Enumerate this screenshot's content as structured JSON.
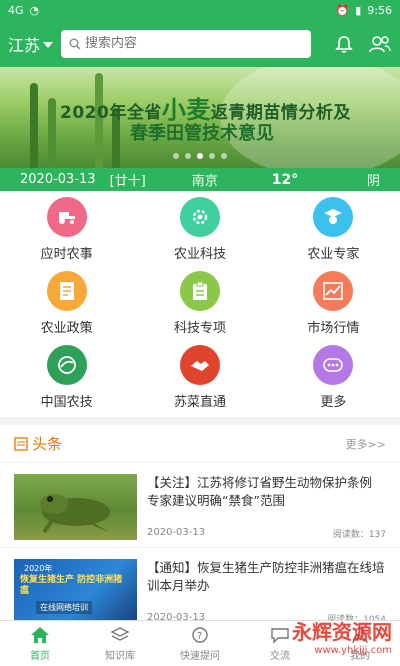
{
  "status_bar": {
    "left": "4G",
    "time": "9:56"
  },
  "header": {
    "city": "江苏",
    "search_placeholder": "搜索内容",
    "bell_icon": "bell-icon",
    "user_icon": "users-icon"
  },
  "banner": {
    "line1_prefix": "2020年全省",
    "line1_highlight": "小麦",
    "line1_suffix": "返青期苗情分析及",
    "line2": "春季田管技术意见",
    "dots_total": 5,
    "dots_active": 2
  },
  "weather": {
    "date": "2020-03-13",
    "lunar": "[廿十]",
    "city": "南京",
    "temp": "12°",
    "condition": "阴"
  },
  "features": [
    {
      "label": "应时农事",
      "icon": "tractor-icon",
      "color": "#f06a87"
    },
    {
      "label": "农业科技",
      "icon": "gear-icon",
      "color": "#3fcfa0"
    },
    {
      "label": "农业专家",
      "icon": "expert-icon",
      "color": "#3cc1ef"
    },
    {
      "label": "农业政策",
      "icon": "document-icon",
      "color": "#f7a838"
    },
    {
      "label": "科技专项",
      "icon": "clipboard-icon",
      "color": "#8bc84a"
    },
    {
      "label": "市场行情",
      "icon": "chart-icon",
      "color": "#f67b5b"
    },
    {
      "label": "中国农技",
      "icon": "globe-icon",
      "color": "#2fa05a"
    },
    {
      "label": "苏菜直通",
      "icon": "handshake-icon",
      "color": "#e0442c"
    },
    {
      "label": "更多",
      "icon": "more-icon",
      "color": "#b479e6"
    }
  ],
  "news_section": {
    "title": "头条",
    "more": "更多>>"
  },
  "news": [
    {
      "headline": "【关注】江苏将修订省野生动物保护条例 专家建议明确“禁食”范围",
      "date": "2020-03-13",
      "reads": "阅读数：137",
      "thumb_icon": "frog-image"
    },
    {
      "headline": "【通知】恢复生猪生产防控非洲猪瘟在线培训本月举办",
      "date": "2020-03-13",
      "reads": "阅读数：1054",
      "thumb_icon": "training-poster-image",
      "thumb_text_year": "2020年",
      "thumb_text_main": "恢复生猪生产 防控非洲猪瘟",
      "thumb_text_sub": "在线网络培训"
    }
  ],
  "tabbar": [
    {
      "label": "首页",
      "icon": "home-icon",
      "active": true
    },
    {
      "label": "知识库",
      "icon": "layers-icon",
      "active": false
    },
    {
      "label": "快速提问",
      "icon": "question-icon",
      "active": false
    },
    {
      "label": "交流",
      "icon": "chat-icon",
      "active": false
    },
    {
      "label": "我的",
      "icon": "person-icon",
      "active": false
    }
  ],
  "watermark": {
    "brand": "永辉资源网",
    "url": "www.yhkjjj.com"
  }
}
